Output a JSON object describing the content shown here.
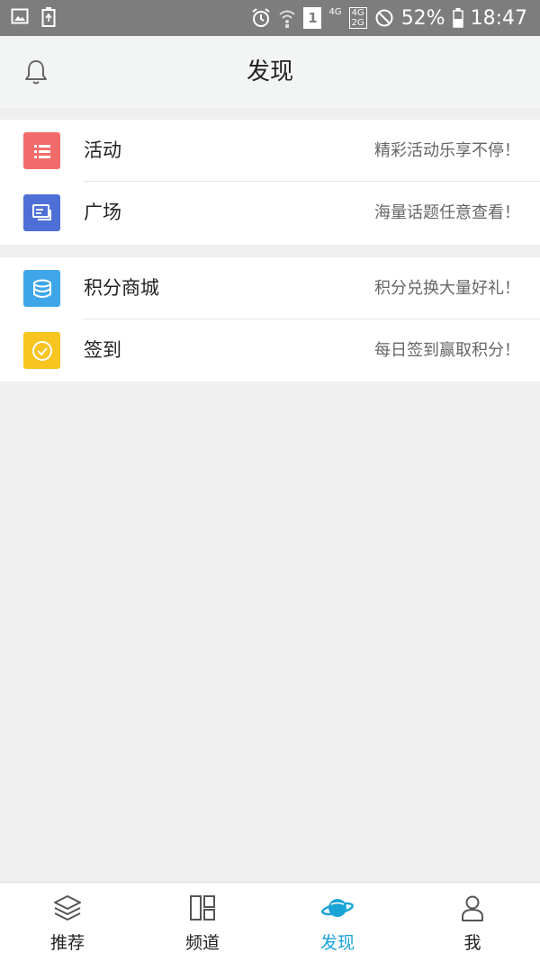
{
  "status_bar": {
    "network_top": "4G",
    "network_stack_a": "4G",
    "network_stack_b": "2G",
    "sim_slot": "1",
    "battery": "52%",
    "time": "18:47"
  },
  "header": {
    "title": "发现"
  },
  "groups": [
    {
      "items": [
        {
          "label": "活动",
          "desc": "精彩活动乐享不停！",
          "icon": "list-icon",
          "color": "#f26b6b"
        },
        {
          "label": "广场",
          "desc": "海量话题任意查看！",
          "icon": "chat-icon",
          "color": "#4e6fd6"
        }
      ]
    },
    {
      "items": [
        {
          "label": "积分商城",
          "desc": "积分兑换大量好礼！",
          "icon": "coins-icon",
          "color": "#3fa6ea"
        },
        {
          "label": "签到",
          "desc": "每日签到赢取积分！",
          "icon": "check-circle-icon",
          "color": "#f7c420"
        }
      ]
    }
  ],
  "tabbar": {
    "tabs": [
      {
        "label": "推荐",
        "icon": "layers-icon",
        "active": false
      },
      {
        "label": "频道",
        "icon": "grid-icon",
        "active": false
      },
      {
        "label": "发现",
        "icon": "planet-icon",
        "active": true
      },
      {
        "label": "我",
        "icon": "person-icon",
        "active": false
      }
    ],
    "active_color": "#1aa3d6"
  }
}
